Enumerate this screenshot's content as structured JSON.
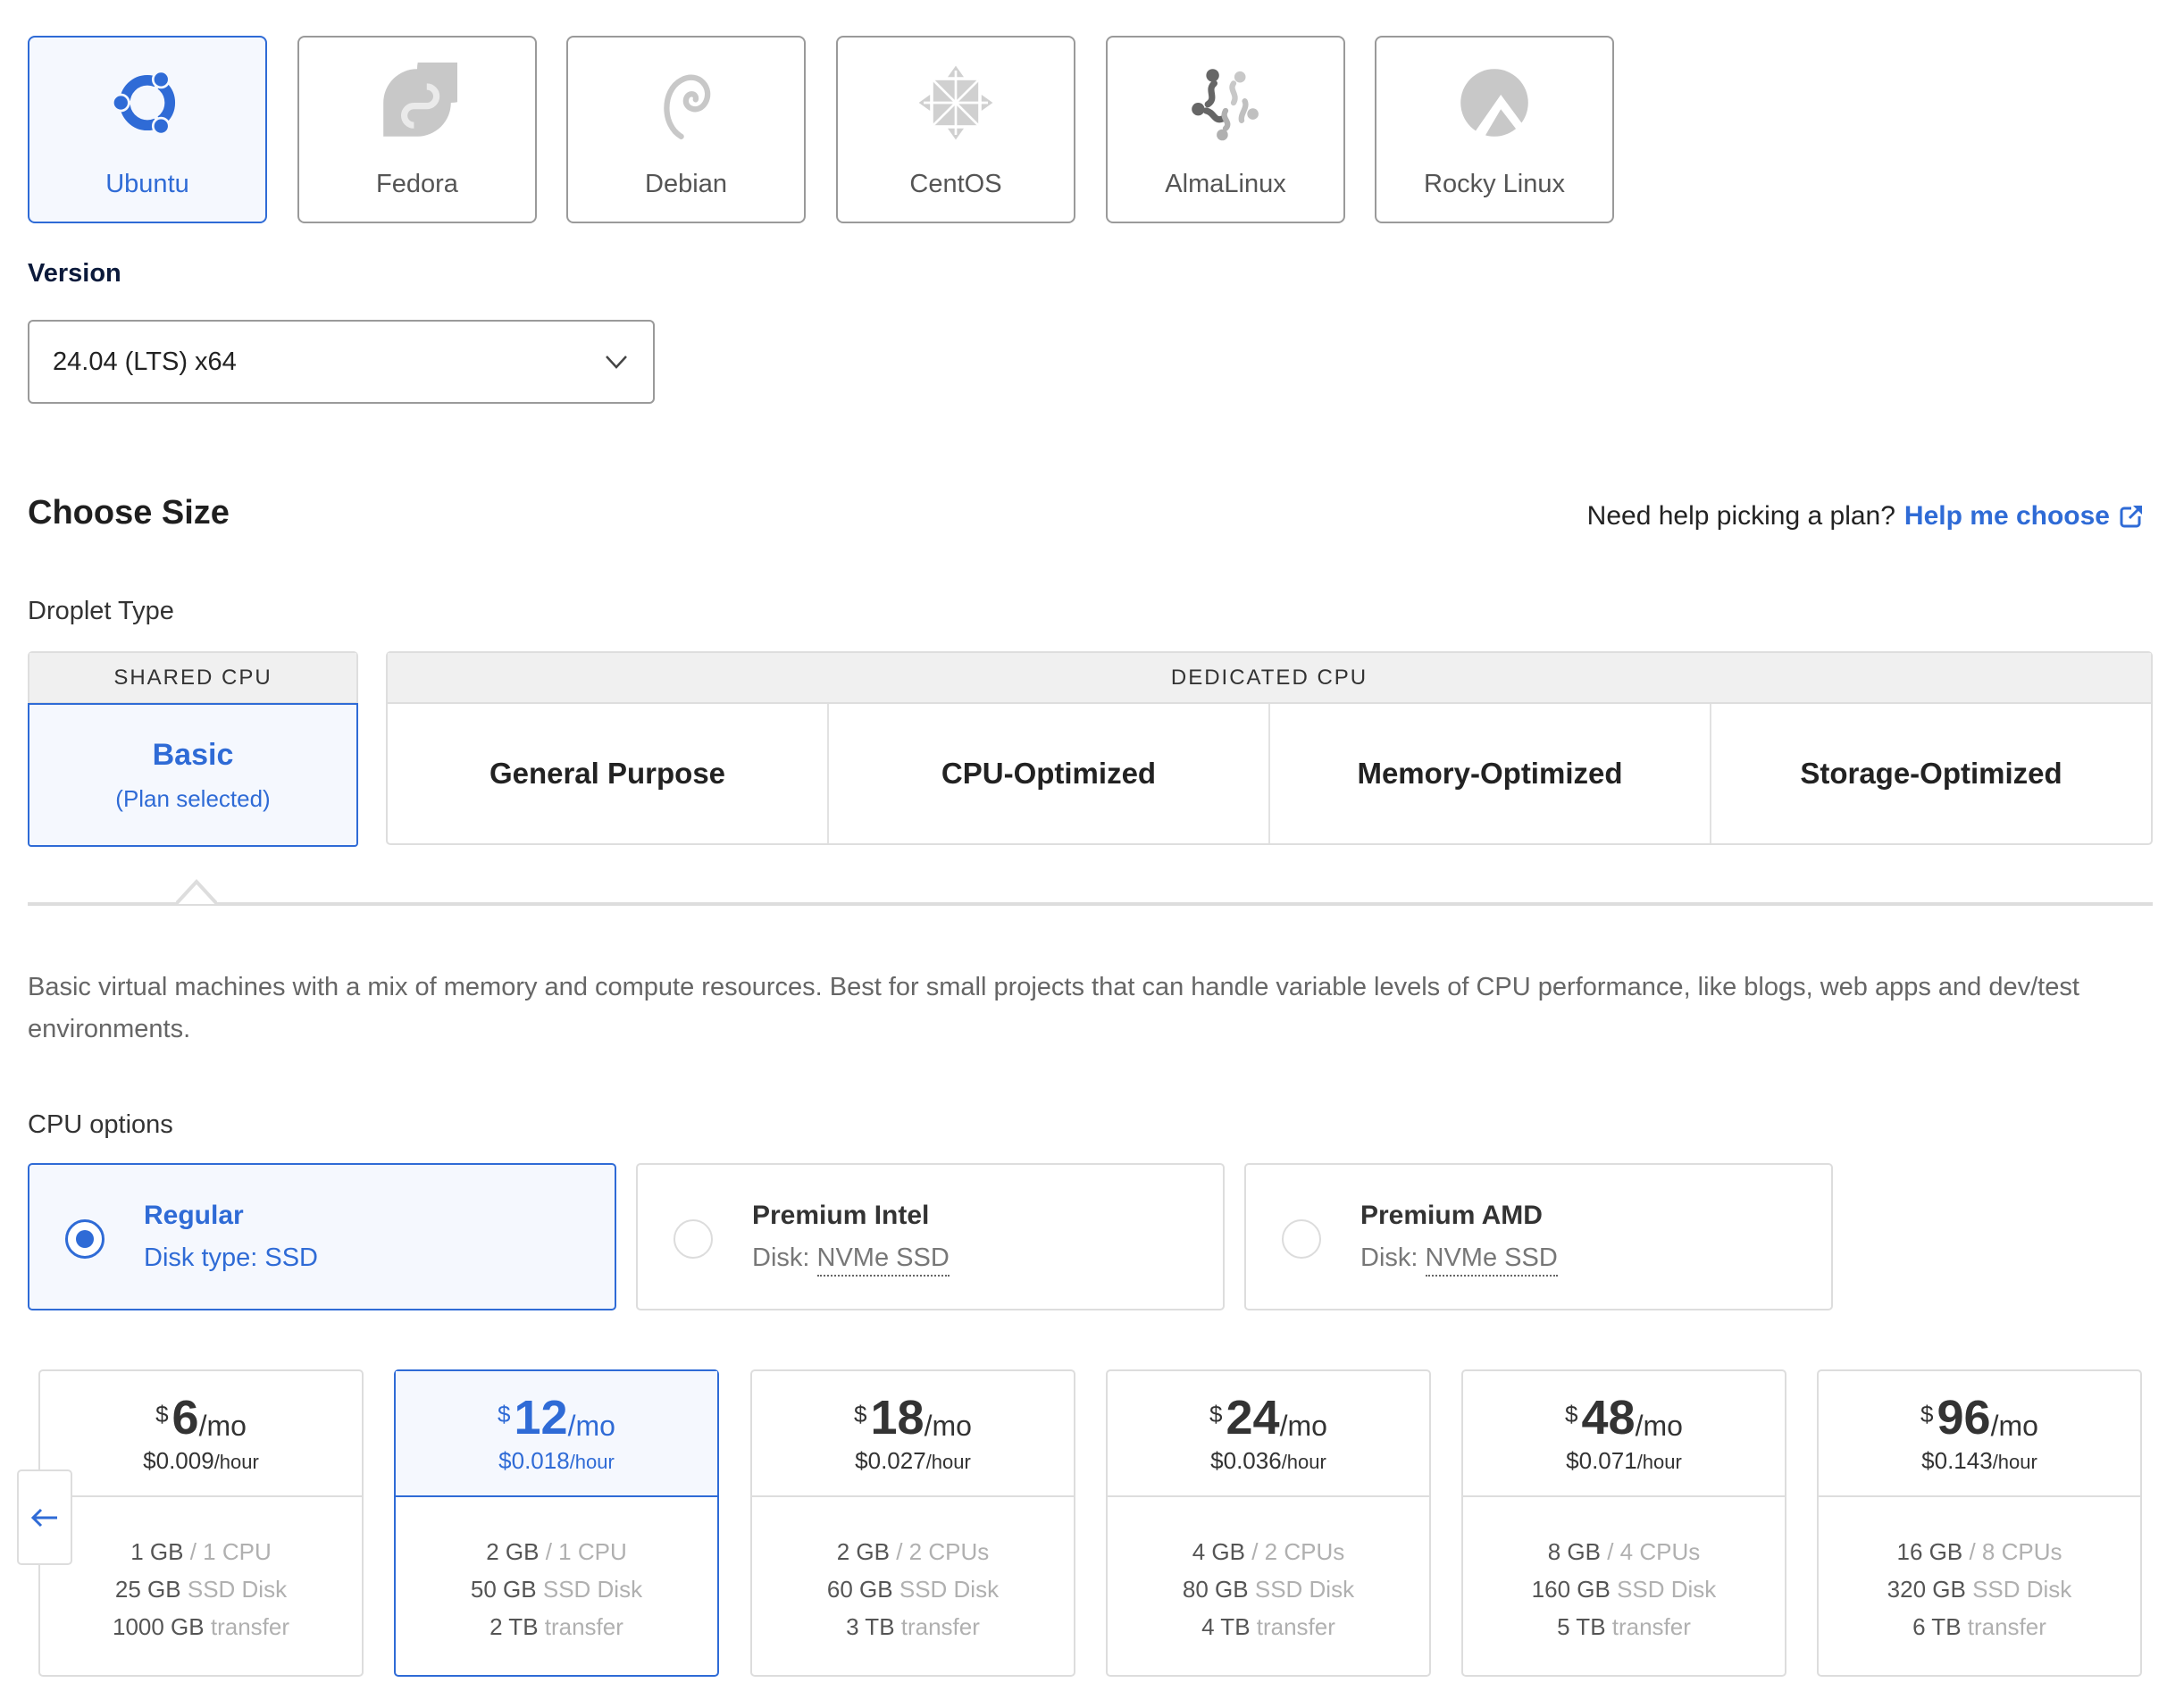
{
  "os": {
    "items": [
      {
        "label": "Ubuntu",
        "icon": "ubuntu-logo",
        "selected": true
      },
      {
        "label": "Fedora",
        "icon": "fedora-logo",
        "selected": false
      },
      {
        "label": "Debian",
        "icon": "debian-logo",
        "selected": false
      },
      {
        "label": "CentOS",
        "icon": "centos-logo",
        "selected": false
      },
      {
        "label": "AlmaLinux",
        "icon": "almalinux-logo",
        "selected": false
      },
      {
        "label": "Rocky Linux",
        "icon": "rocky-linux-logo",
        "selected": false
      }
    ],
    "version_label": "Version",
    "version_value": "24.04 (LTS) x64"
  },
  "size": {
    "title": "Choose Size",
    "help_text": "Need help picking a plan?",
    "help_link": "Help me choose",
    "droplet_type_label": "Droplet Type",
    "shared_header": "SHARED CPU",
    "dedicated_header": "DEDICATED CPU",
    "basic_title": "Basic",
    "basic_subtitle": "(Plan selected)",
    "dedicated_types": [
      "General Purpose",
      "CPU-Optimized",
      "Memory-Optimized",
      "Storage-Optimized"
    ],
    "description": "Basic virtual machines with a mix of memory and compute resources. Best for small projects that can handle variable levels of CPU performance, like blogs, web apps and dev/test environments."
  },
  "cpu": {
    "label": "CPU options",
    "options": [
      {
        "title": "Regular",
        "disk_prefix": "Disk type: ",
        "disk_value": "SSD",
        "selected": true
      },
      {
        "title": "Premium Intel",
        "disk_prefix": "Disk: ",
        "disk_value": "NVMe SSD",
        "selected": false
      },
      {
        "title": "Premium AMD",
        "disk_prefix": "Disk: ",
        "disk_value": "NVMe SSD",
        "selected": false
      }
    ]
  },
  "plans": [
    {
      "currency": "$",
      "monthly": "6",
      "per_month": "/mo",
      "hourly": "$0.009",
      "per_hour": "/hour",
      "mem": "1 GB",
      "cpu": " / 1 CPU",
      "disk": "25 GB",
      "disk_label": " SSD Disk",
      "transfer": "1000 GB",
      "transfer_label": " transfer",
      "selected": false
    },
    {
      "currency": "$",
      "monthly": "12",
      "per_month": "/mo",
      "hourly": "$0.018",
      "per_hour": "/hour",
      "mem": "2 GB",
      "cpu": " / 1 CPU",
      "disk": "50 GB",
      "disk_label": " SSD Disk",
      "transfer": "2 TB",
      "transfer_label": " transfer",
      "selected": true
    },
    {
      "currency": "$",
      "monthly": "18",
      "per_month": "/mo",
      "hourly": "$0.027",
      "per_hour": "/hour",
      "mem": "2 GB",
      "cpu": " / 2 CPUs",
      "disk": "60 GB",
      "disk_label": " SSD Disk",
      "transfer": "3 TB",
      "transfer_label": " transfer",
      "selected": false
    },
    {
      "currency": "$",
      "monthly": "24",
      "per_month": "/mo",
      "hourly": "$0.036",
      "per_hour": "/hour",
      "mem": "4 GB",
      "cpu": " / 2 CPUs",
      "disk": "80 GB",
      "disk_label": " SSD Disk",
      "transfer": "4 TB",
      "transfer_label": " transfer",
      "selected": false
    },
    {
      "currency": "$",
      "monthly": "48",
      "per_month": "/mo",
      "hourly": "$0.071",
      "per_hour": "/hour",
      "mem": "8 GB",
      "cpu": " / 4 CPUs",
      "disk": "160 GB",
      "disk_label": " SSD Disk",
      "transfer": "5 TB",
      "transfer_label": " transfer",
      "selected": false
    },
    {
      "currency": "$",
      "monthly": "96",
      "per_month": "/mo",
      "hourly": "$0.143",
      "per_hour": "/hour",
      "mem": "16 GB",
      "cpu": " / 8 CPUs",
      "disk": "320 GB",
      "disk_label": " SSD Disk",
      "transfer": "6 TB",
      "transfer_label": " transfer",
      "selected": false
    }
  ],
  "colors": {
    "accent": "#2f6bd6",
    "selected_bg": "#f5f8fe",
    "border": "#dddddd"
  }
}
